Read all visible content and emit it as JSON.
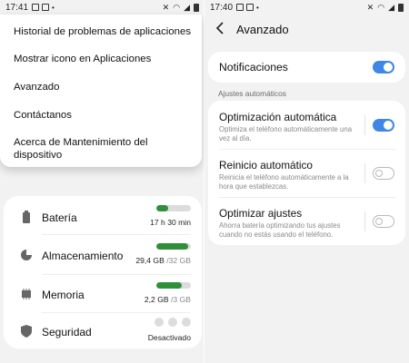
{
  "left": {
    "status": {
      "time": "17:41"
    },
    "popup_menu": [
      {
        "label": "Historial de problemas de aplicaciones"
      },
      {
        "label": "Mostrar icono en Aplicaciones"
      },
      {
        "label": "Avanzado"
      },
      {
        "label": "Contáctanos"
      },
      {
        "label": "Acerca de Mantenimiento del dispositivo"
      }
    ],
    "stats": [
      {
        "label": "Batería",
        "value": "17 h 30 min",
        "bar_fraction": 0.35,
        "icon": "battery-icon"
      },
      {
        "label": "Almacenamiento",
        "value_main": "29,4 GB",
        "value_sub": "/32 GB",
        "bar_fraction": 0.92,
        "icon": "pie-chart-icon"
      },
      {
        "label": "Memoria",
        "value_main": "2,2 GB",
        "value_sub": "/3 GB",
        "bar_fraction": 0.73,
        "icon": "memory-chip-icon"
      },
      {
        "label": "Seguridad",
        "value": "Desactivado",
        "icon": "shield-icon"
      }
    ]
  },
  "right": {
    "status": {
      "time": "17:40"
    },
    "header": {
      "title": "Avanzado"
    },
    "notifications": {
      "label": "Notificaciones",
      "enabled": true
    },
    "section_label": "Ajustes automáticos",
    "options": [
      {
        "name": "Optimización automática",
        "desc": "Optimiza el teléfono automáticamente una vez al día.",
        "enabled": true
      },
      {
        "name": "Reinicio automático",
        "desc": "Reinicia el teléfono automáticamente a la hora que establezcas.",
        "enabled": false
      },
      {
        "name": "Optimizar ajustes",
        "desc": "Ahorra batería optimizando tus ajustes cuando no estás usando el teléfono.",
        "enabled": false
      }
    ]
  },
  "colors": {
    "accent": "#3f86e6",
    "bar_green": "#2f8f3a",
    "background": "#f2f2f2"
  }
}
